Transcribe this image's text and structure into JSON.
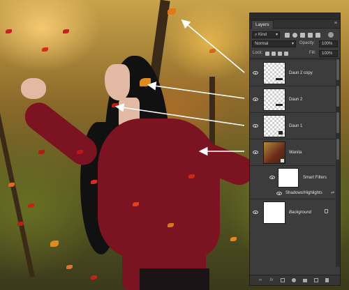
{
  "panel": {
    "tab_label": "Layers",
    "filter_kind_label": "Kind",
    "blend_mode": "Normal",
    "opacity_label": "Opacity:",
    "opacity_value": "100%",
    "lock_label": "Lock:",
    "fill_label": "Fill:",
    "fill_value": "100%"
  },
  "layers": [
    {
      "name": "Daun 2 copy",
      "type": "transparent"
    },
    {
      "name": "Daun 2",
      "type": "transparent"
    },
    {
      "name": "Daun 1",
      "type": "transparent"
    },
    {
      "name": "Wanita",
      "type": "photo"
    },
    {
      "name": "Smart Filters",
      "type": "smart-filters"
    },
    {
      "name": "Shadows/Highlights",
      "type": "filter"
    },
    {
      "name": "Background",
      "type": "background"
    }
  ],
  "colors": {
    "panel_bg": "#3c3c3c",
    "arrow": "#ffffff",
    "sweater": "#7c1320"
  },
  "icons": [
    "eye-icon",
    "search-icon",
    "chevron-down-icon",
    "lock-icon",
    "link-icon",
    "fx-icon",
    "mask-icon",
    "adjustment-icon",
    "folder-icon",
    "new-layer-icon",
    "trash-icon",
    "menu-icon"
  ]
}
